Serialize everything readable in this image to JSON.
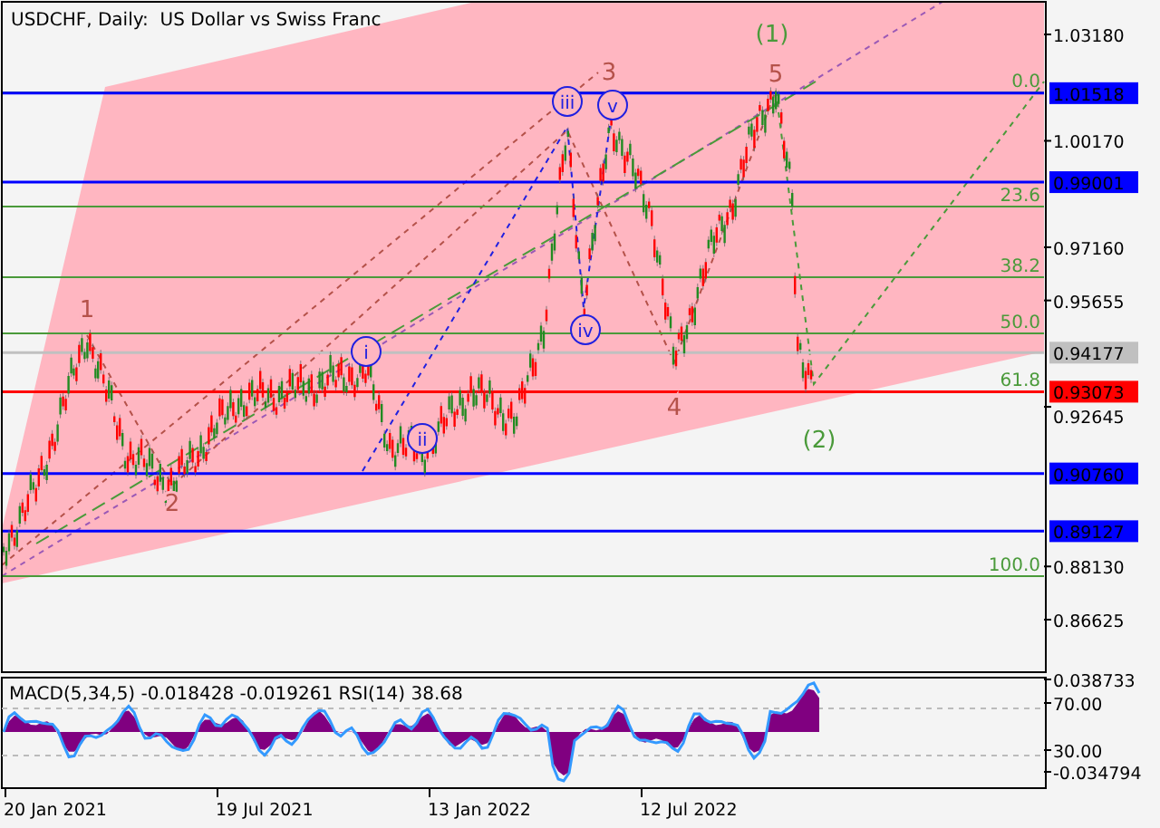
{
  "chart": {
    "title": "USDCHF, Daily:  US Dollar vs Swiss Franc"
  },
  "price_axis": {
    "labels": [
      "1.03180",
      "1.00170",
      "0.97160",
      "0.95655",
      "0.92645",
      "0.88130",
      "0.86625"
    ]
  },
  "price_markers": [
    {
      "label": "1.01518",
      "color": "#0000ff"
    },
    {
      "label": "0.99001",
      "color": "#0000ff"
    },
    {
      "label": "0.94177",
      "color": "#c0c0c0"
    },
    {
      "label": "0.93073",
      "color": "#ff0000"
    },
    {
      "label": "0.90760",
      "color": "#0000ff"
    },
    {
      "label": "0.89127",
      "color": "#0000ff"
    }
  ],
  "fibonacci_levels": [
    {
      "label": "0.0"
    },
    {
      "label": "23.6"
    },
    {
      "label": "38.2"
    },
    {
      "label": "50.0"
    },
    {
      "label": "61.8"
    },
    {
      "label": "100.0"
    }
  ],
  "wave_labels": [
    {
      "label": "1",
      "kind": "major"
    },
    {
      "label": "2",
      "kind": "major"
    },
    {
      "label": "3",
      "kind": "major"
    },
    {
      "label": "4",
      "kind": "major"
    },
    {
      "label": "5",
      "kind": "major"
    },
    {
      "label": "(1)",
      "kind": "primary"
    },
    {
      "label": "(2)",
      "kind": "primary"
    },
    {
      "label": "i",
      "kind": "minor"
    },
    {
      "label": "ii",
      "kind": "minor"
    },
    {
      "label": "iii",
      "kind": "minor"
    },
    {
      "label": "iv",
      "kind": "minor"
    },
    {
      "label": "v",
      "kind": "minor"
    }
  ],
  "indicator": {
    "caption": "MACD(5,34,5) -0.018428 -0.019261 RSI(14) 38.68",
    "axis_labels": [
      "0.038733",
      "70.00",
      "30.00",
      "-0.034794"
    ]
  },
  "date_axis": {
    "labels": [
      "20 Jan 2021",
      "19 Jul 2021",
      "13 Jan 2022",
      "12 Jul 2022"
    ]
  }
}
